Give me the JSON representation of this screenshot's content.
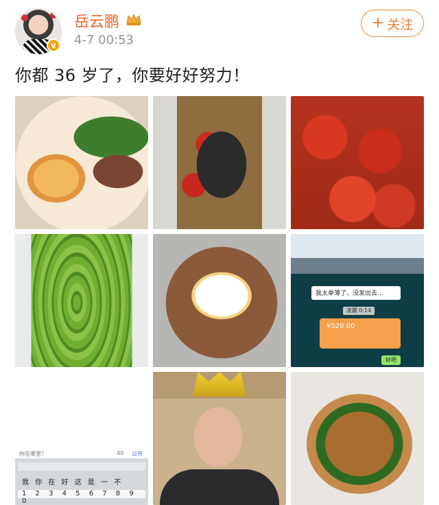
{
  "post": {
    "username": "岳云鹏",
    "timestamp": "4-7 00:53",
    "follow_label": "关注",
    "text": "你都 36 岁了，你要好好努力！"
  },
  "badges": {
    "verified_letter": "v",
    "verified_color": "#f4a10c",
    "crown_color": "#f2a93b"
  },
  "colors": {
    "username": "#e8632b",
    "follow": "#f07b2a",
    "timestamp": "#939393"
  },
  "photos": [
    {
      "id": "photo-1",
      "description": "noodles-with-beef-and-greens"
    },
    {
      "id": "photo-2",
      "description": "preserved-eggs-with-chili"
    },
    {
      "id": "photo-3",
      "description": "spicy-crayfish"
    },
    {
      "id": "photo-4",
      "description": "edamame"
    },
    {
      "id": "photo-5",
      "description": "fried-egg-on-stirfry"
    },
    {
      "id": "photo-6",
      "description": "chat-screenshot"
    },
    {
      "id": "photo-7",
      "description": "keyboard-screenshot"
    },
    {
      "id": "photo-8",
      "description": "man-with-birthday-crown"
    },
    {
      "id": "photo-9",
      "description": "fried-noodles-with-chives"
    }
  ],
  "chat": {
    "message": "我太单薄了，没发出去…",
    "time": "凌晨 0:14",
    "amount": "¥520.00",
    "reply": "好吧"
  },
  "keyboard": {
    "placeholder": "你在哪里？",
    "counter": "40",
    "visibility": "公开",
    "suggestions": "我 你 在 好 这 是 一 不",
    "numbers": "1 2 3 4 5 6 7 8 9 0"
  }
}
